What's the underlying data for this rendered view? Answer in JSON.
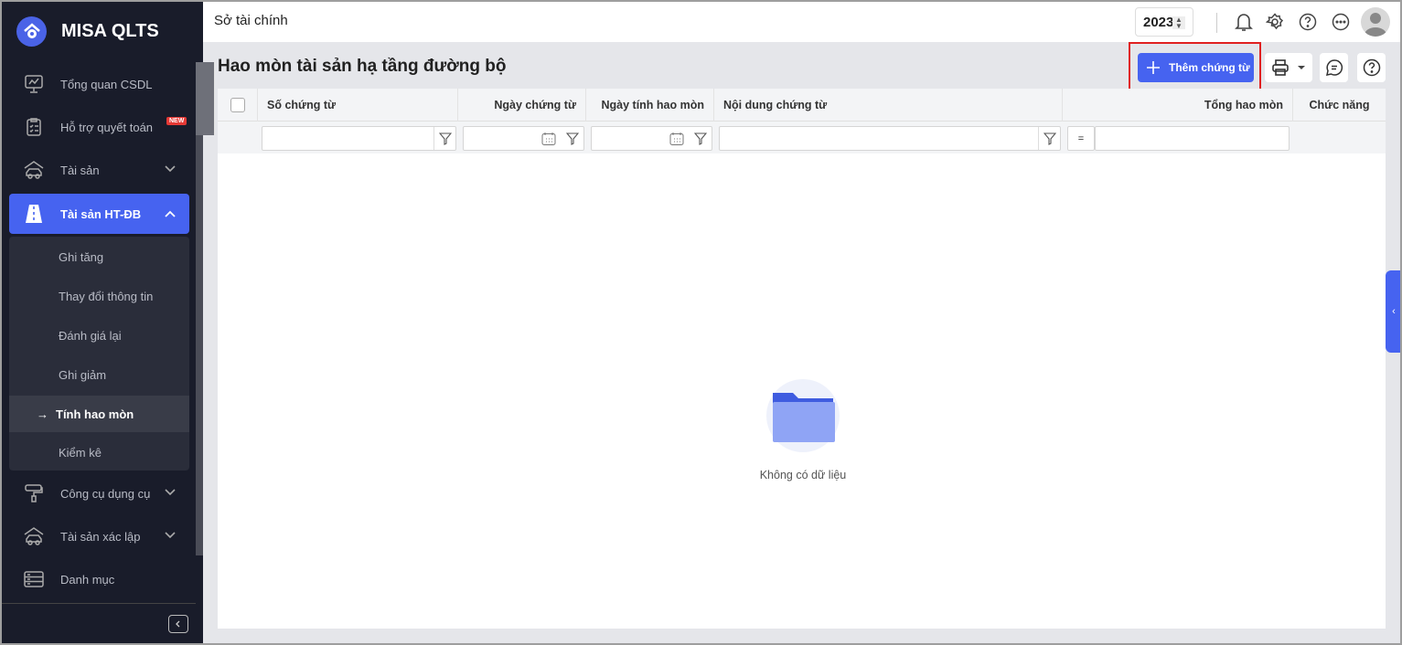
{
  "app": {
    "name": "MISA QLTS"
  },
  "sidebar": {
    "items": [
      {
        "label": "Tổng quan CSDL",
        "icon": "monitor-chart-icon"
      },
      {
        "label": "Hỗ trợ quyết toán",
        "icon": "clipboard-icon",
        "badge": "NEW"
      },
      {
        "label": "Tài sản",
        "icon": "house-car-icon"
      },
      {
        "label": "Tài sản HT-ĐB",
        "icon": "road-icon"
      },
      {
        "label": "Công cụ dụng cụ",
        "icon": "paint-roller-icon"
      },
      {
        "label": "Tài sản xác lập",
        "icon": "house-car-icon"
      },
      {
        "label": "Danh mục",
        "icon": "list-icon"
      }
    ],
    "subitems": [
      {
        "label": "Ghi tăng"
      },
      {
        "label": "Thay đổi thông tin"
      },
      {
        "label": "Đánh giá lại"
      },
      {
        "label": "Ghi giảm"
      },
      {
        "label": "Tính hao mòn"
      },
      {
        "label": "Kiểm kê"
      }
    ],
    "selected_marker": "→"
  },
  "topbar": {
    "org": "Sở tài chính",
    "year": "2023"
  },
  "page": {
    "title": "Hao mòn tài sản hạ tầng đường bộ",
    "add_label": "Thêm chứng từ"
  },
  "table": {
    "columns": [
      "Số chứng từ",
      "Ngày chứng từ",
      "Ngày tính hao mòn",
      "Nội dung chứng từ",
      "Tổng hao mòn",
      "Chức năng"
    ],
    "operator": "=",
    "empty_text": "Không có dữ liệu"
  },
  "colors": {
    "accent": "#4663f0",
    "sidebar": "#191c2a",
    "highlight": "#e02020"
  }
}
